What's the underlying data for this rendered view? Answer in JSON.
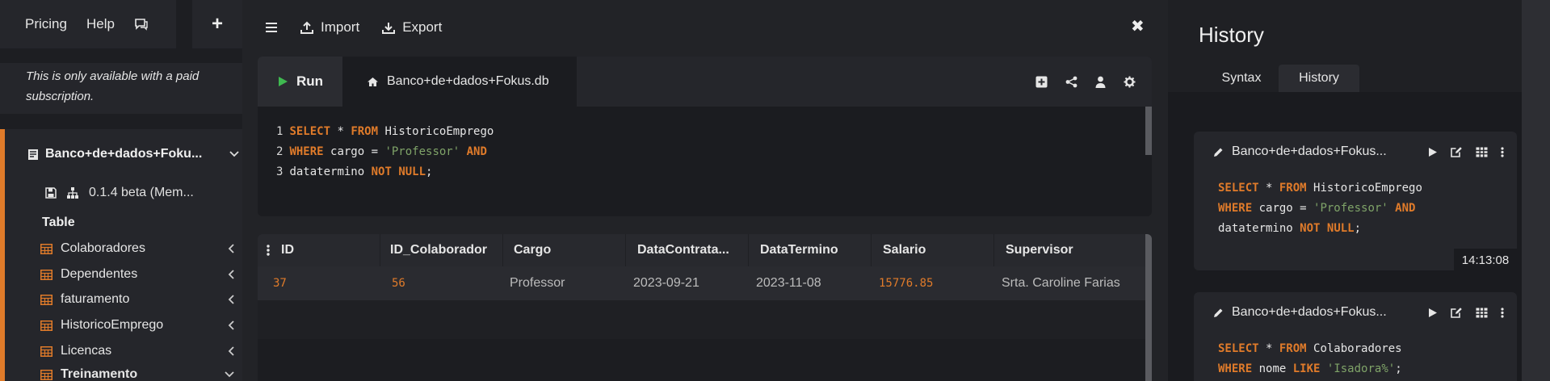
{
  "nav": {
    "pricing": "Pricing",
    "help": "Help",
    "plus": "+"
  },
  "paid_note": "This is only available with a paid subscription.",
  "database": {
    "name": "Banco+de+dados+Foku...",
    "version": "0.1.4 beta (Mem...",
    "table_header": "Table",
    "tables": [
      {
        "label": "Colaboradores"
      },
      {
        "label": "Dependentes"
      },
      {
        "label": "faturamento"
      },
      {
        "label": "HistoricoEmprego"
      },
      {
        "label": "Licencas"
      },
      {
        "label": "Treinamento"
      }
    ]
  },
  "toolbar": {
    "import": "Import",
    "export": "Export",
    "close": "✖"
  },
  "editor": {
    "run": "Run",
    "file": "Banco+de+dados+Fokus.db",
    "lines": [
      {
        "n": "1",
        "parts": [
          {
            "t": "SELECT",
            "c": "kw"
          },
          {
            "t": " * ",
            "c": ""
          },
          {
            "t": "FROM",
            "c": "kw"
          },
          {
            "t": " HistoricoEmprego",
            "c": ""
          }
        ]
      },
      {
        "n": "2",
        "parts": [
          {
            "t": "WHERE",
            "c": "kw"
          },
          {
            "t": " cargo = ",
            "c": ""
          },
          {
            "t": "'Professor'",
            "c": "str"
          },
          {
            "t": " ",
            "c": ""
          },
          {
            "t": "AND",
            "c": "kw"
          }
        ]
      },
      {
        "n": "3",
        "parts": [
          {
            "t": "datatermino ",
            "c": ""
          },
          {
            "t": "NOT",
            "c": "kw"
          },
          {
            "t": " ",
            "c": ""
          },
          {
            "t": "NULL",
            "c": "kw"
          },
          {
            "t": ";",
            "c": ""
          }
        ]
      }
    ]
  },
  "results": {
    "columns": [
      "ID",
      "ID_Colaborador",
      "Cargo",
      "DataContrata...",
      "DataTermino",
      "Salario",
      "Supervisor"
    ],
    "row": [
      "37",
      "56",
      "Professor",
      "2023-09-21",
      "2023-11-08",
      "15776.85",
      "Srta. Caroline Farias"
    ]
  },
  "history": {
    "title": "History",
    "tabs": {
      "syntax": "Syntax",
      "history": "History"
    },
    "entries": [
      {
        "db": "Banco+de+dados+Fokus...",
        "time": "14:13:08",
        "lines": [
          [
            {
              "t": "SELECT",
              "c": "kw"
            },
            {
              "t": " * ",
              "c": ""
            },
            {
              "t": "FROM",
              "c": "kw"
            },
            {
              "t": " HistoricoEmprego",
              "c": ""
            }
          ],
          [
            {
              "t": "WHERE",
              "c": "kw"
            },
            {
              "t": " cargo = ",
              "c": ""
            },
            {
              "t": "'Professor'",
              "c": "str"
            },
            {
              "t": " ",
              "c": ""
            },
            {
              "t": "AND",
              "c": "kw"
            }
          ],
          [
            {
              "t": "datatermino ",
              "c": ""
            },
            {
              "t": "NOT",
              "c": "kw"
            },
            {
              "t": " ",
              "c": ""
            },
            {
              "t": "NULL",
              "c": "kw"
            },
            {
              "t": ";",
              "c": ""
            }
          ]
        ]
      },
      {
        "db": "Banco+de+dados+Fokus...",
        "lines": [
          [
            {
              "t": "SELECT",
              "c": "kw"
            },
            {
              "t": " * ",
              "c": ""
            },
            {
              "t": "FROM",
              "c": "kw"
            },
            {
              "t": " Colaboradores",
              "c": ""
            }
          ],
          [
            {
              "t": "WHERE",
              "c": "kw"
            },
            {
              "t": " nome ",
              "c": ""
            },
            {
              "t": "LIKE",
              "c": "kw"
            },
            {
              "t": " ",
              "c": ""
            },
            {
              "t": "'Isadora%'",
              "c": "str"
            },
            {
              "t": ";",
              "c": ""
            }
          ]
        ]
      }
    ]
  },
  "colors": {
    "accent": "#e07b2a",
    "string": "#7fa368",
    "run": "#3fb950"
  },
  "icons": [
    "comments-icon",
    "hamburger-icon",
    "upload-icon",
    "download-icon",
    "play-icon",
    "home-icon",
    "plus-square-icon",
    "share-icon",
    "user-icon",
    "gear-icon",
    "save-icon",
    "sitemap-icon",
    "table-icon",
    "chevron-left-icon",
    "chevron-down-icon",
    "pencil-icon",
    "edit-icon",
    "kebab-icon",
    "database-icon"
  ]
}
